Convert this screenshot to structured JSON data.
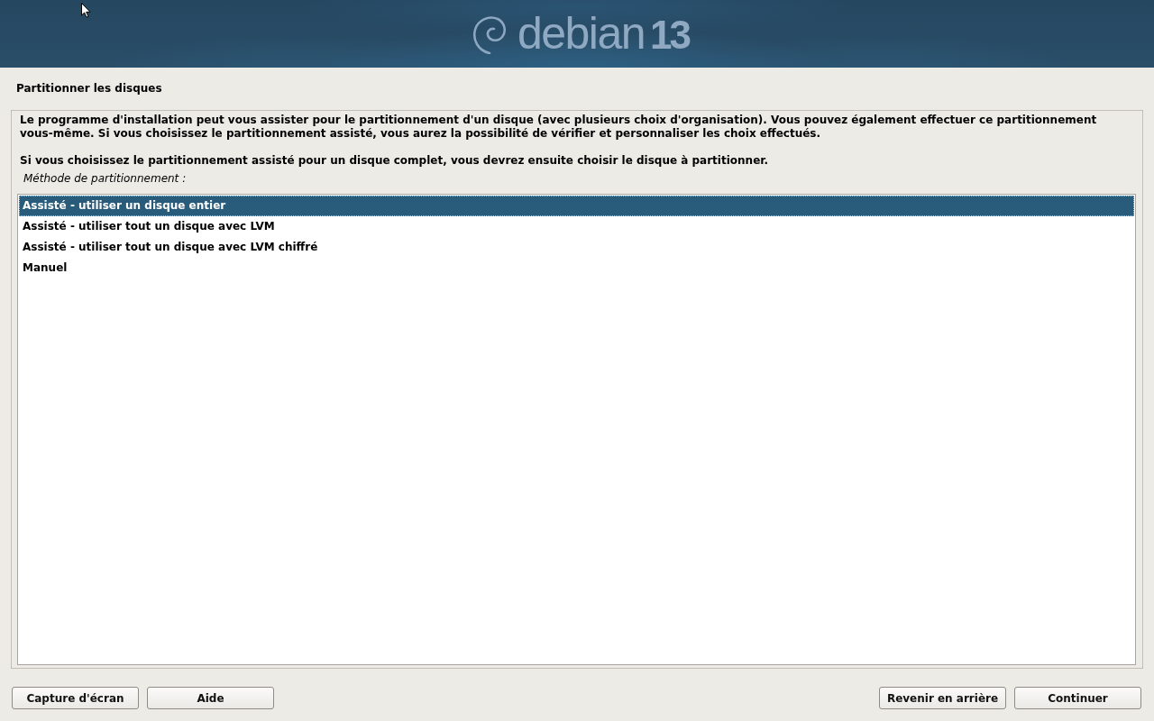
{
  "banner": {
    "logo_text": "debian",
    "version": "13"
  },
  "title": "Partitionner les disques",
  "paragraphs": [
    "Le programme d'installation peut vous assister pour le partitionnement d'un disque (avec plusieurs choix d'organisation). Vous pouvez également effectuer ce partitionnement vous-même. Si vous choisissez le partitionnement assisté, vous aurez la possibilité de vérifier et personnaliser les choix effectués.",
    "Si vous choisissez le partitionnement assisté pour un disque complet, vous devrez ensuite choisir le disque à partitionner."
  ],
  "question": {
    "label": "Méthode de partitionnement :",
    "options": [
      {
        "label": "Assisté - utiliser un disque entier",
        "selected": true
      },
      {
        "label": "Assisté - utiliser tout un disque avec LVM",
        "selected": false
      },
      {
        "label": "Assisté - utiliser tout un disque avec LVM chiffré",
        "selected": false
      },
      {
        "label": "Manuel",
        "selected": false
      }
    ]
  },
  "left_buttons": [
    "Capture d'écran",
    "Aide"
  ],
  "right_buttons": [
    "Revenir en arrière",
    "Continuer"
  ]
}
